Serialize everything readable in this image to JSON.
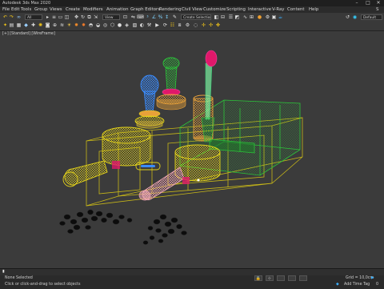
{
  "app": {
    "title": "Autodesk 3ds Max 2020"
  },
  "window_controls": {
    "minimize": "–",
    "maximize": "□",
    "close": "✕"
  },
  "menu": {
    "items": [
      "File",
      "Edit",
      "Tools",
      "Group",
      "Views",
      "Create",
      "Modifiers",
      "Animation",
      "Graph Editors",
      "Rendering",
      "Civil View",
      "Customize",
      "Scripting",
      "Interactive",
      "V-Ray",
      "Content",
      "Help"
    ],
    "workspace_partial": "S"
  },
  "toolbar": {
    "selection_set": "Create Selection Se",
    "filter": "All",
    "reference": "View",
    "workspace": "Default"
  },
  "viewport": {
    "label": "[+] [Standard] [WireFrame]"
  },
  "status": {
    "selection_info": "None Selected",
    "prompt": "Click or click-and-drag to select objects",
    "grid": "Grid = 10,0cm",
    "time_tag": "Add Time Tag",
    "time": "0"
  },
  "colors": {
    "wire_yellow": "#e3d21a",
    "wire_green": "#2cc53a",
    "wire_blue": "#3a8cff",
    "wire_pink": "#f0a6b4",
    "wire_magenta": "#e0186a",
    "wire_orange": "#e8a13a"
  }
}
